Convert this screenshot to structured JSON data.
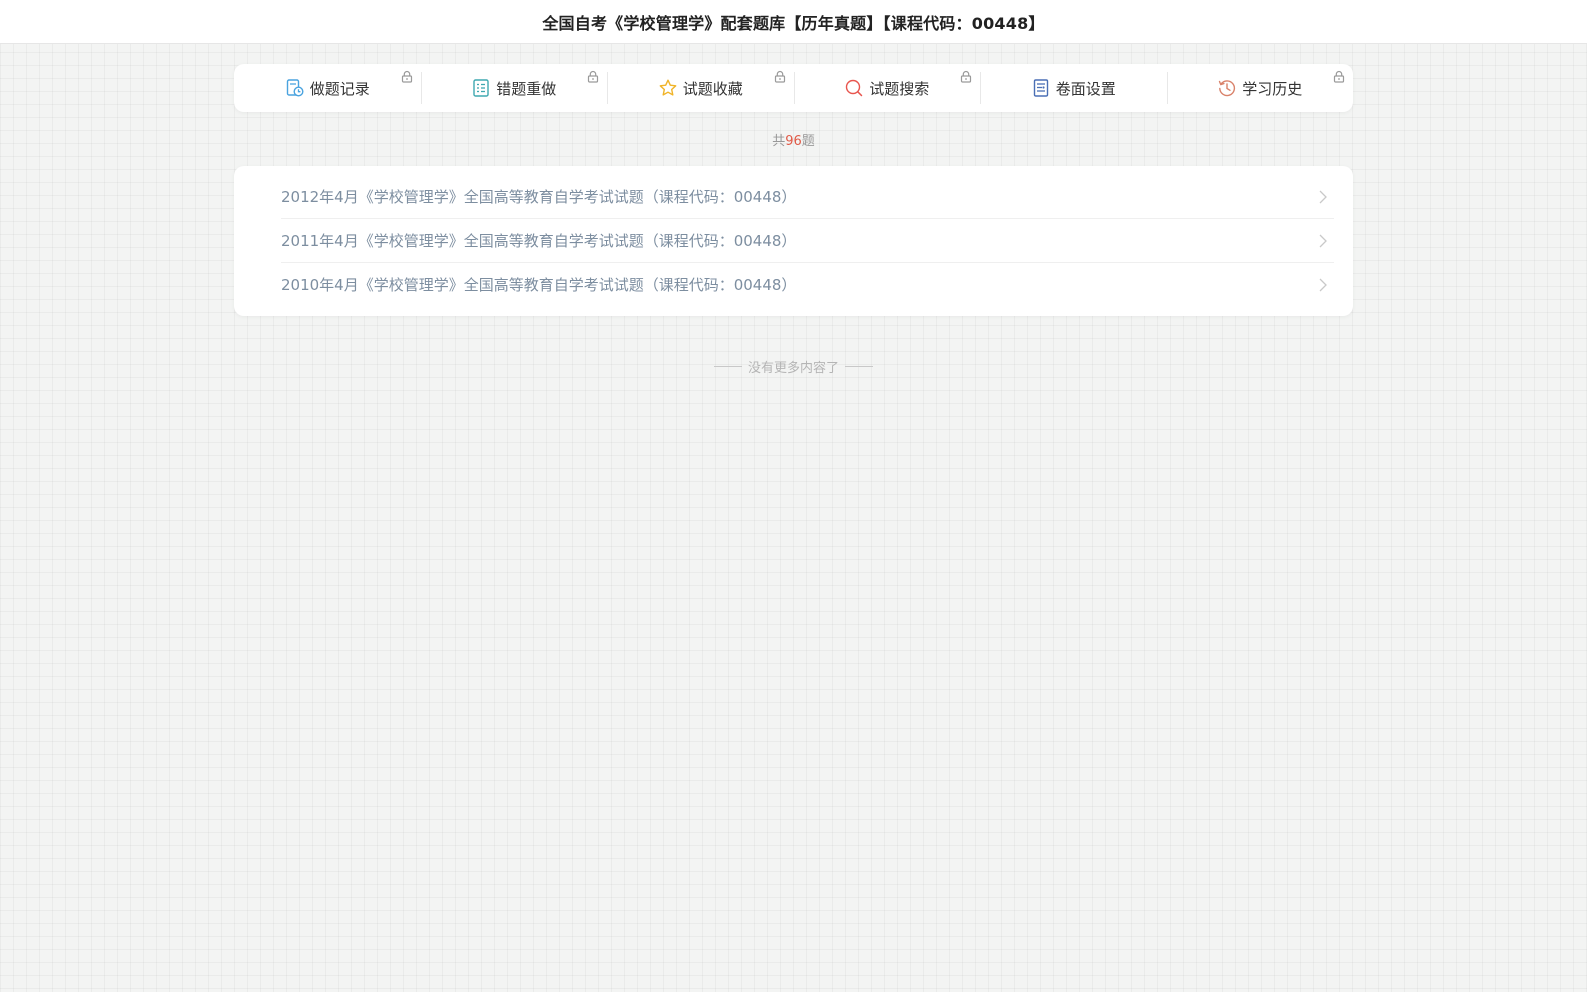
{
  "header": {
    "title": "全国自考《学校管理学》配套题库【历年真题】【课程代码：00448】"
  },
  "toolbar": {
    "items": [
      {
        "label": "做题记录",
        "icon": "record-icon",
        "locked": true
      },
      {
        "label": "错题重做",
        "icon": "redo-list-icon",
        "locked": true
      },
      {
        "label": "试题收藏",
        "icon": "star-icon",
        "locked": true
      },
      {
        "label": "试题搜索",
        "icon": "search-icon",
        "locked": true
      },
      {
        "label": "卷面设置",
        "icon": "settings-doc-icon",
        "locked": false
      },
      {
        "label": "学习历史",
        "icon": "history-icon",
        "locked": true
      }
    ]
  },
  "summary": {
    "prefix": "共",
    "count": "96",
    "suffix": "题"
  },
  "papers": [
    {
      "title": "2012年4月《学校管理学》全国高等教育自学考试试题（课程代码：00448）"
    },
    {
      "title": "2011年4月《学校管理学》全国高等教育自学考试试题（课程代码：00448）"
    },
    {
      "title": "2010年4月《学校管理学》全国高等教育自学考试试题（课程代码：00448）"
    }
  ],
  "footer": {
    "no_more": "没有更多内容了"
  },
  "colors": {
    "count_accent": "#e05a47",
    "paper_text": "#7d8ea0",
    "record_icon": "#4aa3df",
    "redo_icon": "#3fa8b0",
    "star_icon": "#f0b429",
    "search_icon": "#e8554e",
    "settings_icon": "#4a6fb5",
    "history_icon": "#d9826a",
    "lock_icon": "#9a9a9a"
  }
}
